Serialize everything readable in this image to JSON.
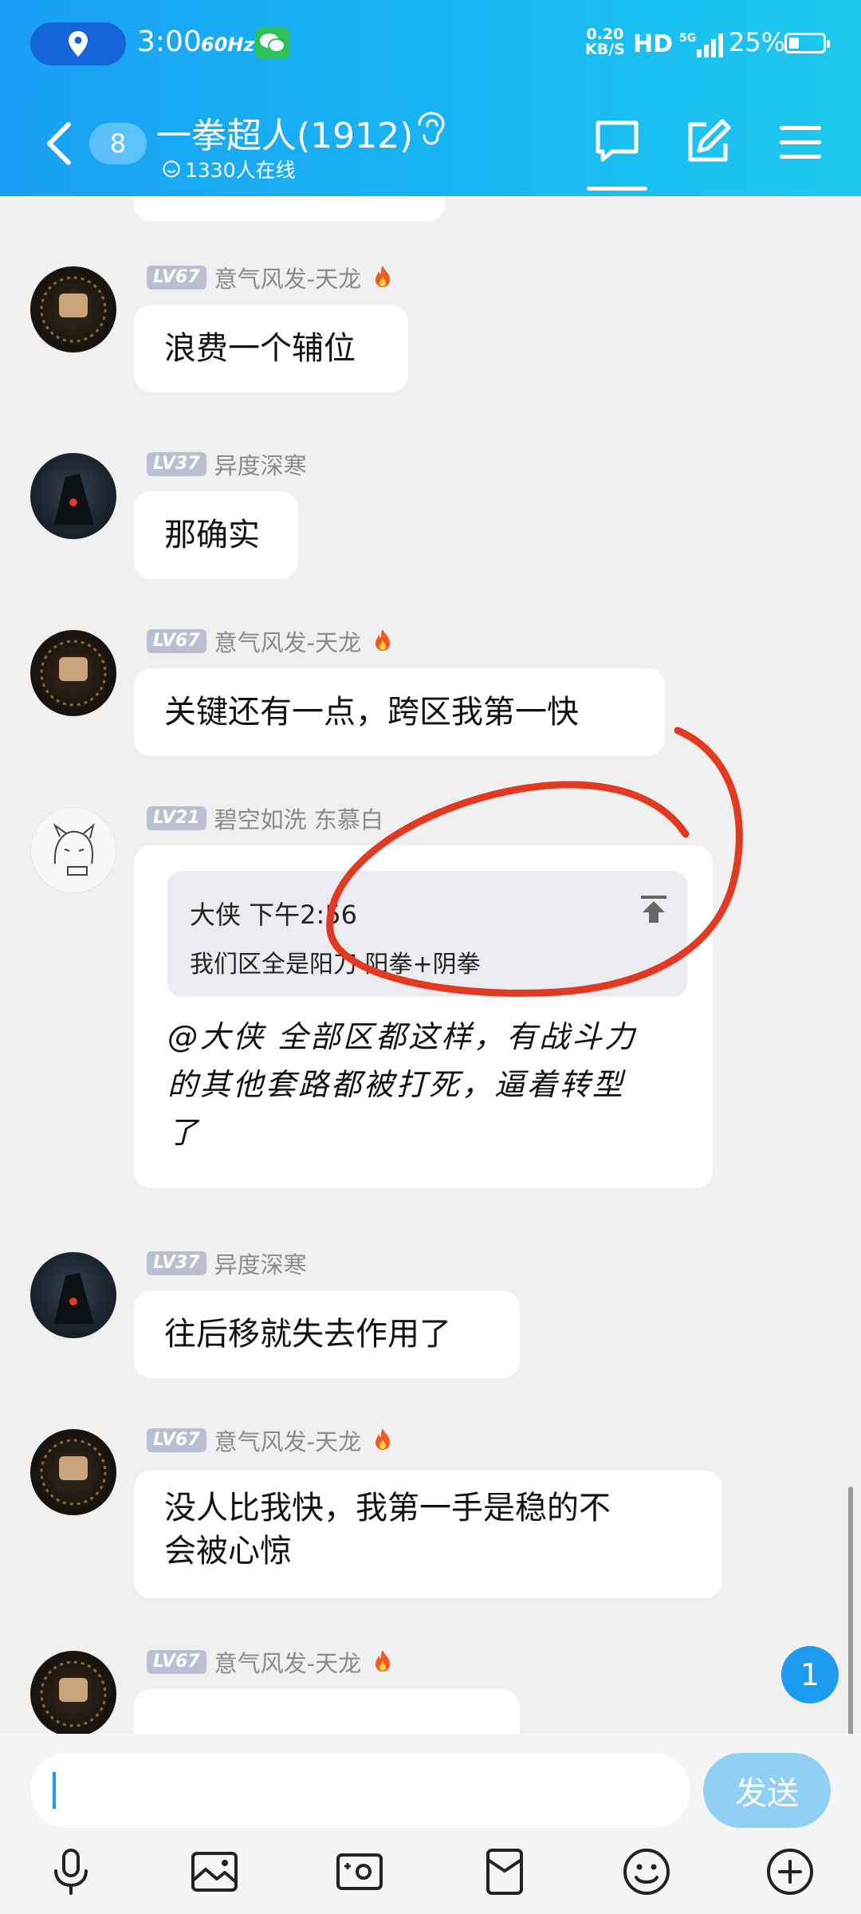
{
  "status_bar": {
    "time": "3:00",
    "refresh": "60Hz",
    "net_speed_value": "0.20",
    "net_speed_unit": "KB/S",
    "hd": "HD",
    "signal_type": "5G",
    "battery": "25%"
  },
  "header": {
    "unread_count": "8",
    "title": "一拳超人(1912)",
    "online": "1330人在线"
  },
  "messages": [
    {
      "level": "LV67",
      "name": "意气风发-天龙",
      "text": "浪费一个辅位",
      "fire": true
    },
    {
      "level": "LV37",
      "name": "异度深寒",
      "text": "那确实",
      "fire": false
    },
    {
      "level": "LV67",
      "name": "意气风发-天龙",
      "text": "关键还有一点，跨区我第一快",
      "fire": true
    },
    {
      "level": "LV21",
      "name": "碧空如洗  东慕白",
      "fire": false,
      "quote": {
        "author_time": "大侠 下午2:56",
        "text": "我们区全是阳刀 阳拳+阴拳"
      },
      "reply_lines": [
        "@大侠 全部区都这样，有战斗力",
        "的其他套路都被打死，逼着转型",
        "了"
      ]
    },
    {
      "level": "LV37",
      "name": "异度深寒",
      "text": "往后移就失去作用了",
      "fire": false
    },
    {
      "level": "LV67",
      "name": "意气风发-天龙",
      "text_lines": [
        "没人比我快，我第一手是稳的不",
        "会被心惊"
      ],
      "fire": true
    },
    {
      "level": "LV67",
      "name": "意气风发-天龙",
      "fire": true
    }
  ],
  "new_message_count": "1",
  "composer": {
    "placeholder": "",
    "send_label": "发送"
  },
  "toolbar_icons": [
    "microphone-icon",
    "image-icon",
    "video-icon",
    "red-packet-icon",
    "emoji-icon",
    "plus-icon"
  ],
  "colors": {
    "header_blue": "#1aa0f5",
    "accent": "#1c9bf0",
    "annotation_red": "#e23a22"
  }
}
